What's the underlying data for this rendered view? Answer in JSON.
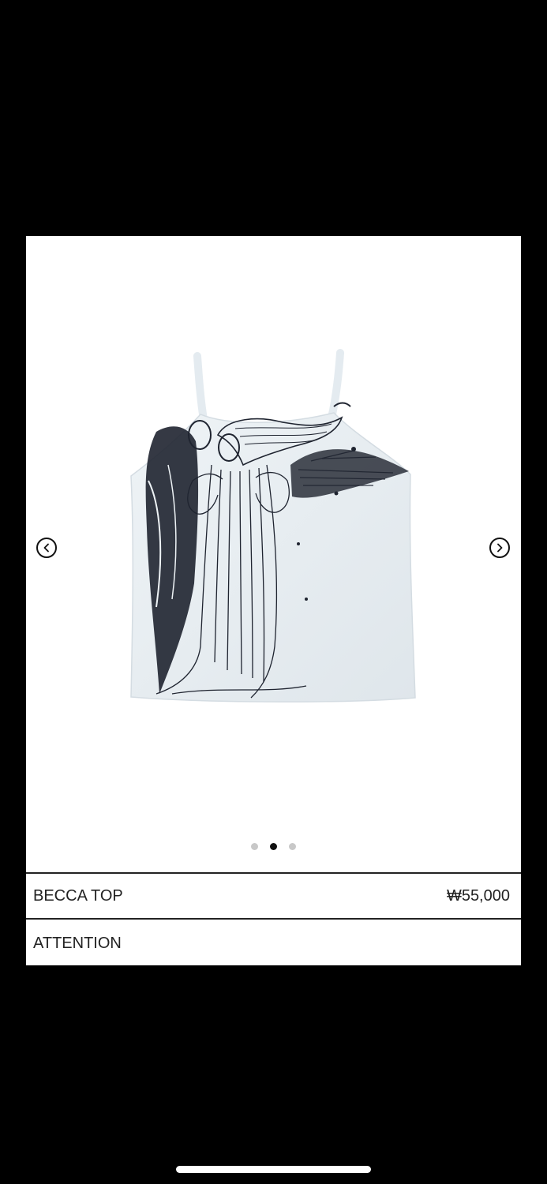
{
  "gallery": {
    "image_alt": "BECCA TOP",
    "current_slide": 2,
    "slide_count": 3,
    "prev_icon": "chevron-left-circle-icon",
    "next_icon": "chevron-right-circle-icon"
  },
  "product": {
    "name": "BECCA TOP",
    "price": "₩55,000"
  },
  "sections": {
    "attention_label": "ATTENTION"
  },
  "colors": {
    "background": "#000000",
    "card": "#ffffff",
    "garment": "#e8eef2",
    "print": "#1f2430",
    "dot_inactive": "#c8c8c8",
    "dot_active": "#111111"
  }
}
